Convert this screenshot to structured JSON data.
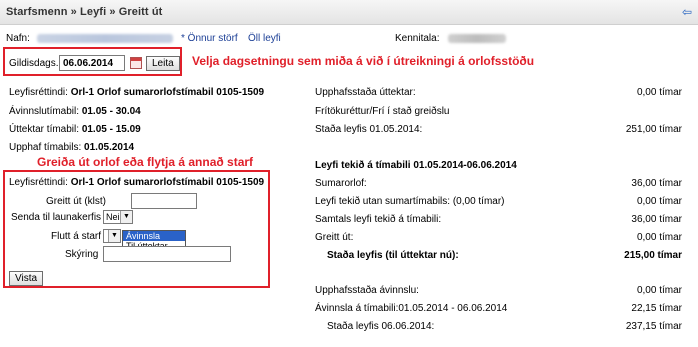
{
  "header": {
    "breadcrumb": "Starfsmenn » Leyfi » Greitt út",
    "back_icon": "back-arrow-icon"
  },
  "employee": {
    "name_label": "Nafn:",
    "filter_star": "* Önnur störf",
    "filter_all": "Öll leyfi",
    "id_label": "Kennitala:"
  },
  "date_search": {
    "label": "Gildisdags.",
    "value": "06.06.2014",
    "button": "Leita",
    "annotation": "Velja dagsetningu sem miða á við í útreikningi á orlofsstöðu"
  },
  "left_info": {
    "rows": [
      {
        "label": "Leyfisréttindi:",
        "value": "Orl-1 Orlof sumarorlofstímabil 0105-1509"
      },
      {
        "label": "Ávinnslutímabil:",
        "value": "01.05 - 30.04"
      },
      {
        "label": "Úttektar tímabil:",
        "value": "01.05 - 15.09"
      },
      {
        "label": "Upphaf tímabils:",
        "value": "01.05.2014"
      }
    ]
  },
  "payout_form": {
    "annotation": "Greiða út orlof eða flytja á annað starf",
    "entitlement_label": "Leyfisréttindi:",
    "entitlement_value": "Orl-1 Orlof sumarorlofstímabil 0105-1509",
    "paid_label": "Greitt út (klst)",
    "paid_value": "",
    "send_label": "Senda til launakerfis",
    "send_value": "Nei",
    "move_label": "Flutt á starf",
    "move_value": "",
    "move_options": [
      "Ávinnsla",
      "Til úttektar"
    ],
    "explain_label": "Skýring",
    "explain_value": "",
    "submit": "Vista"
  },
  "right_top": {
    "rows": [
      {
        "label": "Upphafsstaða úttektar:",
        "value": "0,00 tímar"
      },
      {
        "label": "Frítökuréttur/Frí í stað greiðslu",
        "value": ""
      },
      {
        "label": "Staða leyfis 01.05.2014:",
        "value": "251,00 tímar"
      }
    ]
  },
  "right_period": {
    "heading": "Leyfi tekið á tímabili 01.05.2014-06.06.2014",
    "rows": [
      {
        "label": "Sumarorlof:",
        "value": "36,00 tímar"
      },
      {
        "label": "Leyfi tekið utan sumartímabils:  (0,00 tímar)",
        "value": "0,00 tímar"
      },
      {
        "label": "Samtals leyfi tekið á tímabili:",
        "value": "36,00 tímar"
      },
      {
        "label": "Greitt út:",
        "value": "0,00 tímar"
      }
    ],
    "status_label": "Staða leyfis (til úttektar nú):",
    "status_value": "215,00 tímar"
  },
  "right_accrual": {
    "rows": [
      {
        "label": "Upphafsstaða ávinnslu:",
        "value": "0,00 tímar"
      },
      {
        "label": "Ávinnsla á tímabili:01.05.2014 - 06.06.2014",
        "value": "22,15 tímar"
      },
      {
        "label": "Staða leyfis 06.06.2014:",
        "value": "237,15 tímar"
      }
    ]
  },
  "colors": {
    "annotation_red": "#e0202a",
    "link_blue": "#1c3f96"
  }
}
